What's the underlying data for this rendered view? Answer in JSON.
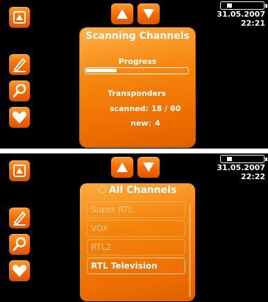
{
  "status": {
    "battery_level": 0.15,
    "date": "31.05.2007",
    "time_1": "22:21",
    "time_2": "22:22"
  },
  "nav": {
    "up_icon": "up-arrow-icon",
    "down_icon": "down-arrow-icon",
    "top_left_icon": "up-triangle-icon",
    "side_icons": [
      "pen-icon",
      "magnifier-icon",
      "heart-icon"
    ]
  },
  "scan": {
    "title": "Scanning Channels",
    "progress_label": "Progress",
    "progress": 0.3,
    "transponders_label": "Transponders",
    "scanned_label": "scanned:",
    "scanned_value": "18 / 60",
    "new_label": "new:",
    "new_value": "4"
  },
  "channels": {
    "title": "All Channels",
    "items": [
      "Super RTL",
      "VOX",
      "RTL2",
      "RTL Television"
    ],
    "selected_index": 3
  },
  "colors": {
    "accent": "#f57a00",
    "background": "#000000"
  }
}
